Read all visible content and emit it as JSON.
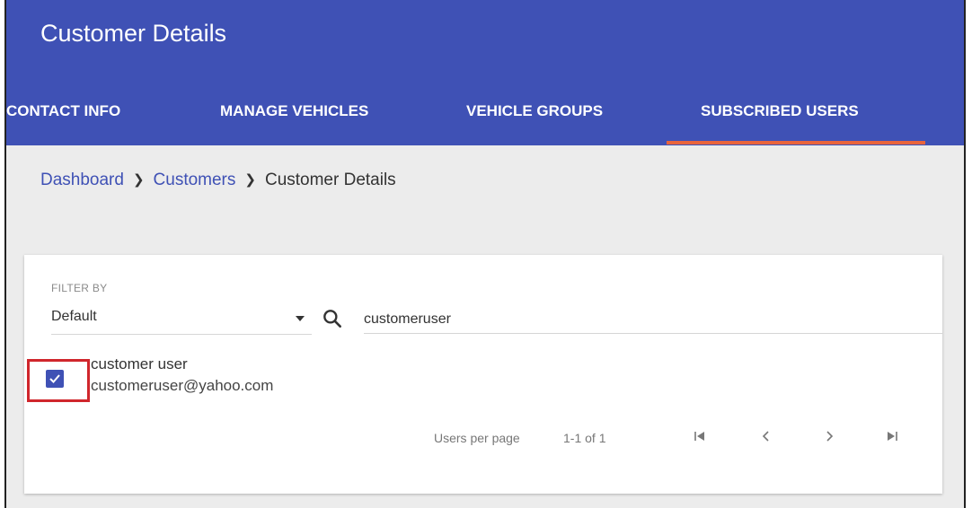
{
  "header": {
    "title": "Customer Details",
    "bg_color": "#3f51b5",
    "tabs": [
      {
        "label": "CONTACT INFO"
      },
      {
        "label": "MANAGE VEHICLES"
      },
      {
        "label": "VEHICLE GROUPS"
      },
      {
        "label": "SUBSCRIBED USERS",
        "active": true
      }
    ],
    "active_tab_color": "#e8643c"
  },
  "breadcrumb": {
    "items": [
      {
        "label": "Dashboard",
        "link": true
      },
      {
        "label": "Customers",
        "link": true
      },
      {
        "label": "Customer Details",
        "link": false
      }
    ],
    "separator_icon": "chevron-right-icon"
  },
  "filter": {
    "label": "FILTER BY",
    "selected": "Default",
    "dropdown_icon": "caret-down-icon"
  },
  "search": {
    "icon": "search-icon",
    "value": "customeruser"
  },
  "users": [
    {
      "name": "customer user",
      "email": "customeruser@yahoo.com",
      "checked": true
    }
  ],
  "pagination": {
    "per_page_label": "Users per page",
    "range": "1-1 of 1",
    "first_icon": "first-page-icon",
    "prev_icon": "chevron-left-icon",
    "next_icon": "chevron-right-icon",
    "last_icon": "last-page-icon"
  },
  "colors": {
    "primary": "#3f51b5",
    "highlight": "#d0262c"
  }
}
